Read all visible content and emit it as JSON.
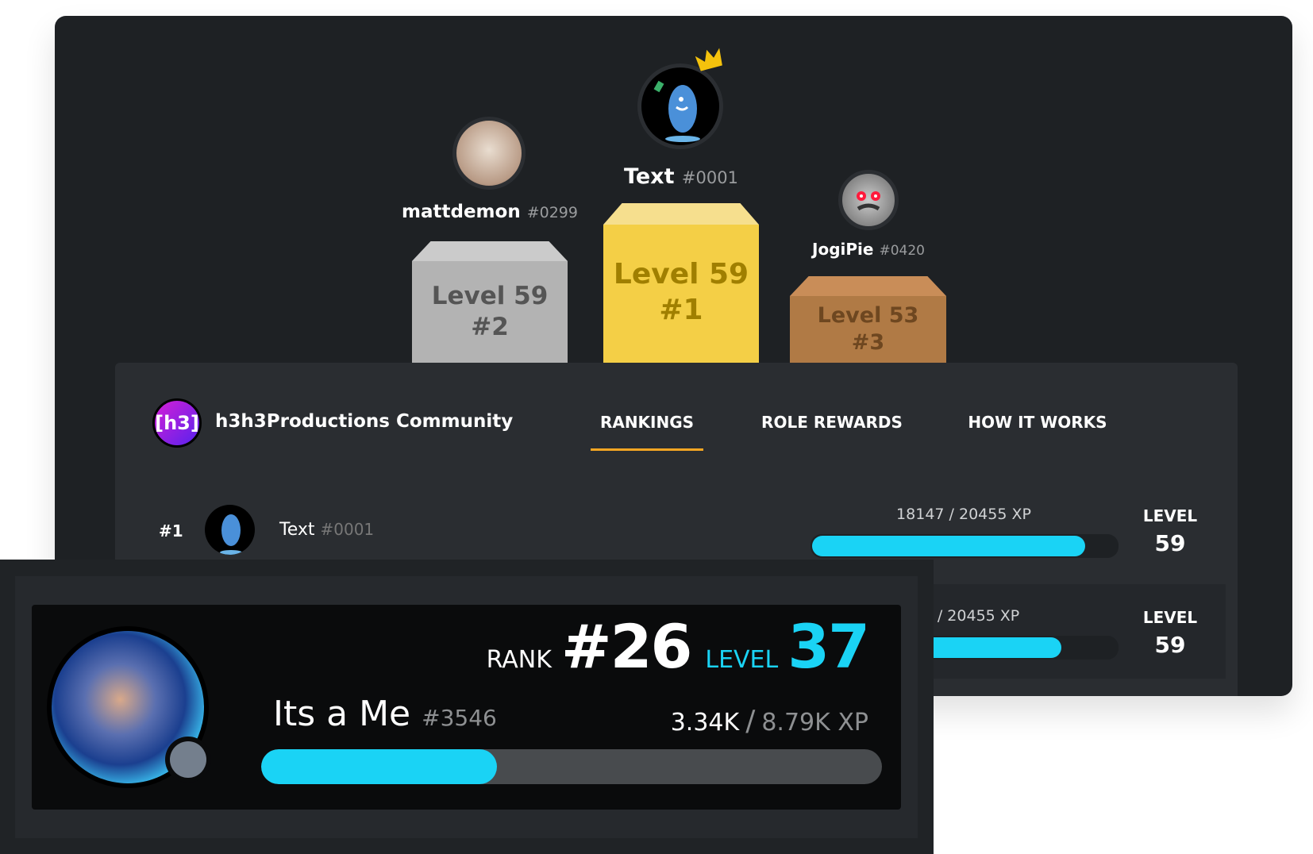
{
  "podium": [
    {
      "place": "#2",
      "name": "mattdemon",
      "disc": "#0299",
      "level": "Level 59",
      "color": "#b3b3b3"
    },
    {
      "place": "#1",
      "name": "Text",
      "disc": "#0001",
      "level": "Level 59",
      "color": "#f4cf46",
      "crown": "crown-icon"
    },
    {
      "place": "#3",
      "name": "JogiPie",
      "disc": "#0420",
      "level": "Level 53",
      "color": "#b07a45"
    }
  ],
  "header": {
    "logo_text": "[h3]",
    "server_name": "h3h3Productions Community",
    "tabs": [
      {
        "label": "RANKINGS",
        "active": true
      },
      {
        "label": "ROLE REWARDS"
      },
      {
        "label": "HOW IT WORKS"
      }
    ]
  },
  "rows": [
    {
      "rank": "#1",
      "name": "Text",
      "disc": "#0001",
      "xp": "18147 / 20455 XP",
      "progress": 0.887,
      "level_label": "LEVEL",
      "level": "59"
    },
    {
      "xp": "…5 / 20455 XP",
      "progress": 0.85,
      "level_label": "LEVEL",
      "level": "59"
    }
  ],
  "card": {
    "rank_label": "RANK",
    "rank": "#26",
    "level_label": "LEVEL",
    "level": "37",
    "name": "Its a Me",
    "disc": "#3546",
    "xp_current": "3.34K",
    "xp_sep": "/",
    "xp_total": "8.79K XP",
    "progress": 0.38
  },
  "colors": {
    "accent": "#1ad3f5",
    "tab_underline": "#f5a623",
    "gold": "#f4cf46",
    "silver": "#b3b3b3",
    "bronze": "#b07a45"
  }
}
